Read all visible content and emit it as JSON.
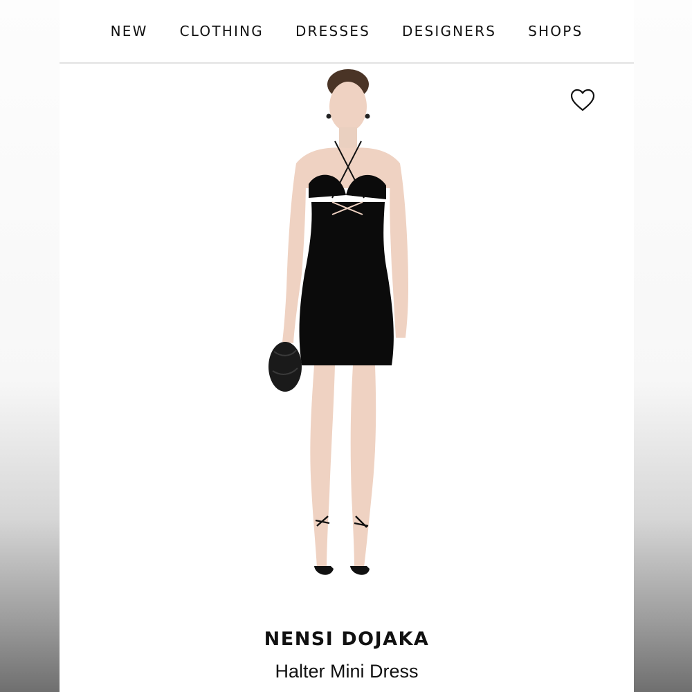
{
  "nav": {
    "items": [
      {
        "label": "NEW"
      },
      {
        "label": "CLOTHING"
      },
      {
        "label": "DRESSES"
      },
      {
        "label": "DESIGNERS"
      },
      {
        "label": "SHOPS"
      }
    ]
  },
  "product": {
    "brand": "NENSI DOJAKA",
    "name": "Halter Mini Dress",
    "wishlist_icon": "heart-outline-icon"
  },
  "colors": {
    "text": "#111111",
    "divider": "#e2e2e2",
    "dress": "#0b0b0b",
    "skin": "#f0d3c4"
  }
}
